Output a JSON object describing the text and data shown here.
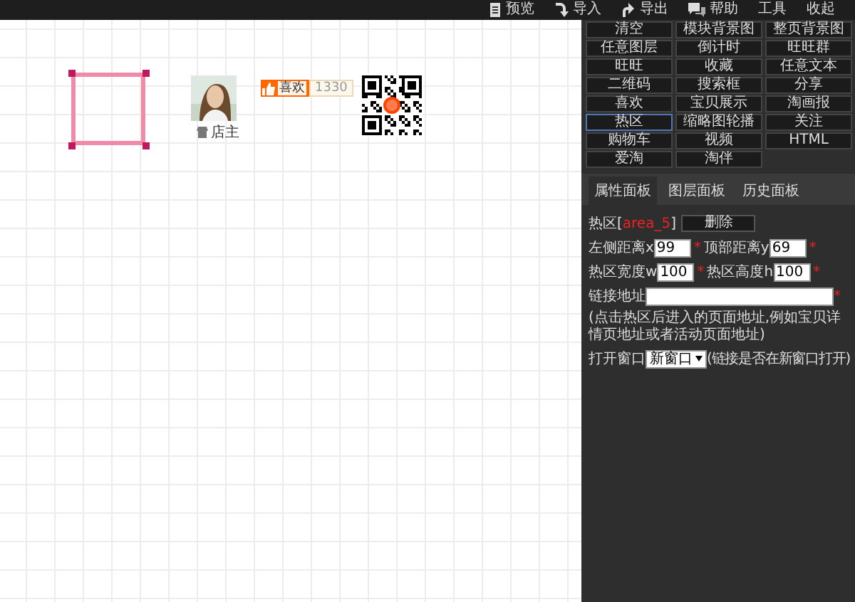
{
  "toolbar": [
    {
      "label": "预览"
    },
    {
      "label": "导入"
    },
    {
      "label": "导出"
    },
    {
      "label": "帮助"
    },
    {
      "label": "工具"
    },
    {
      "label": "收起"
    }
  ],
  "canvas": {
    "avatar": {
      "caption": "店主"
    },
    "like": {
      "label": "喜欢",
      "count": "1330"
    }
  },
  "components": [
    {
      "label": "清空",
      "selected": false
    },
    {
      "label": "模块背景图",
      "selected": false
    },
    {
      "label": "整页背景图",
      "selected": false
    },
    {
      "label": "任意图层",
      "selected": false
    },
    {
      "label": "倒计时",
      "selected": false
    },
    {
      "label": "旺旺群",
      "selected": false
    },
    {
      "label": "旺旺",
      "selected": false
    },
    {
      "label": "收藏",
      "selected": false
    },
    {
      "label": "任意文本",
      "selected": false
    },
    {
      "label": "二维码",
      "selected": false
    },
    {
      "label": "搜索框",
      "selected": false
    },
    {
      "label": "分享",
      "selected": false
    },
    {
      "label": "喜欢",
      "selected": false
    },
    {
      "label": "宝贝展示",
      "selected": false
    },
    {
      "label": "淘画报",
      "selected": false
    },
    {
      "label": "热区",
      "selected": true
    },
    {
      "label": "缩略图轮播",
      "selected": false
    },
    {
      "label": "关注",
      "selected": false
    },
    {
      "label": "购物车",
      "selected": false
    },
    {
      "label": "视频",
      "selected": false
    },
    {
      "label": "HTML",
      "selected": false
    },
    {
      "label": "爱淘",
      "selected": false
    },
    {
      "label": "淘伴",
      "selected": false
    }
  ],
  "tabs": [
    {
      "label": "属性面板",
      "selected": true
    },
    {
      "label": "图层面板",
      "selected": false
    },
    {
      "label": "历史面板",
      "selected": false
    }
  ],
  "properties": {
    "hotzone": {
      "label": "热区[",
      "id": "area_5",
      "close": "]"
    },
    "delete_button": "删除",
    "fields": [
      {
        "label": "左侧距离x",
        "value": "99",
        "mark": "*"
      },
      {
        "label": "顶部距离y",
        "value": "69",
        "mark": "*"
      },
      {
        "label": "热区宽度w",
        "value": "100",
        "mark": "*"
      },
      {
        "label": "热区高度h",
        "value": "100",
        "mark": "*"
      }
    ],
    "link": {
      "label": "链接地址",
      "mark": "*"
    },
    "hint": "(点击热区后进入的页面地址,例如宝贝详情页地址或者活动页面地址)",
    "open_window": {
      "label": "打开窗口",
      "value": "新窗口",
      "note": "(链接是否在新窗口打开)"
    }
  }
}
